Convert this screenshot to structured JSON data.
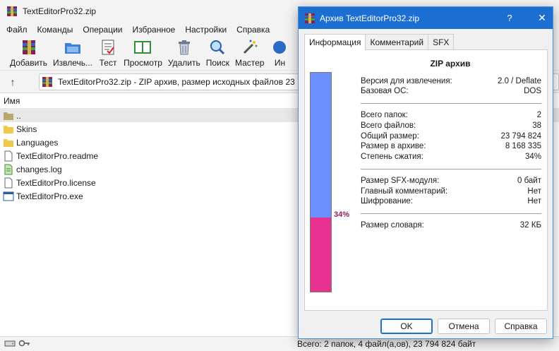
{
  "window": {
    "title": "TextEditorPro32.zip"
  },
  "menu": [
    "Файл",
    "Команды",
    "Операции",
    "Избранное",
    "Настройки",
    "Справка"
  ],
  "toolbar": {
    "add": "Добавить",
    "extract": "Извлечь...",
    "test": "Тест",
    "view": "Просмотр",
    "delete": "Удалить",
    "find": "Поиск",
    "wizard": "Мастер",
    "info": "Ин"
  },
  "address": {
    "text": "TextEditorPro32.zip - ZIP архив, размер исходных файлов 23 794 824 байт"
  },
  "list": {
    "header_name": "Имя",
    "items": [
      {
        "name": "..",
        "type": "up"
      },
      {
        "name": "Skins",
        "type": "folder"
      },
      {
        "name": "Languages",
        "type": "folder"
      },
      {
        "name": "TextEditorPro.readme",
        "type": "file"
      },
      {
        "name": "changes.log",
        "type": "log"
      },
      {
        "name": "TextEditorPro.license",
        "type": "file"
      },
      {
        "name": "TextEditorPro.exe",
        "type": "exe"
      }
    ]
  },
  "status": {
    "text": "Всего: 2 папок, 4 файл(а,ов), 23 794 824 байт"
  },
  "dialog": {
    "title": "Архив TextEditorPro32.zip",
    "help": "?",
    "close": "✕",
    "tabs": [
      "Информация",
      "Комментарий",
      "SFX"
    ],
    "heading": "ZIP архив",
    "ratio_percent": 34,
    "ratio_label": "34%",
    "rows": [
      {
        "label": "Версия для извлечения:",
        "value": "2.0 / Deflate"
      },
      {
        "label": "Базовая ОС:",
        "value": "DOS"
      },
      {
        "label": "Всего папок:",
        "value": "2"
      },
      {
        "label": "Всего файлов:",
        "value": "38"
      },
      {
        "label": "Общий размер:",
        "value": "23 794 824"
      },
      {
        "label": "Размер в архиве:",
        "value": "8 168 335"
      },
      {
        "label": "Степень сжатия:",
        "value": "34%"
      },
      {
        "label": "Размер SFX-модуля:",
        "value": "0 байт"
      },
      {
        "label": "Главный комментарий:",
        "value": "Нет"
      },
      {
        "label": "Шифрование:",
        "value": "Нет"
      },
      {
        "label": "Размер словаря:",
        "value": "32 КБ"
      }
    ],
    "buttons": {
      "ok": "OK",
      "cancel": "Отмена",
      "help": "Справка"
    }
  },
  "colors": {
    "accent": "#1c6fd1",
    "ratio_top": "#6a8fff",
    "ratio_bottom": "#e8318f"
  }
}
